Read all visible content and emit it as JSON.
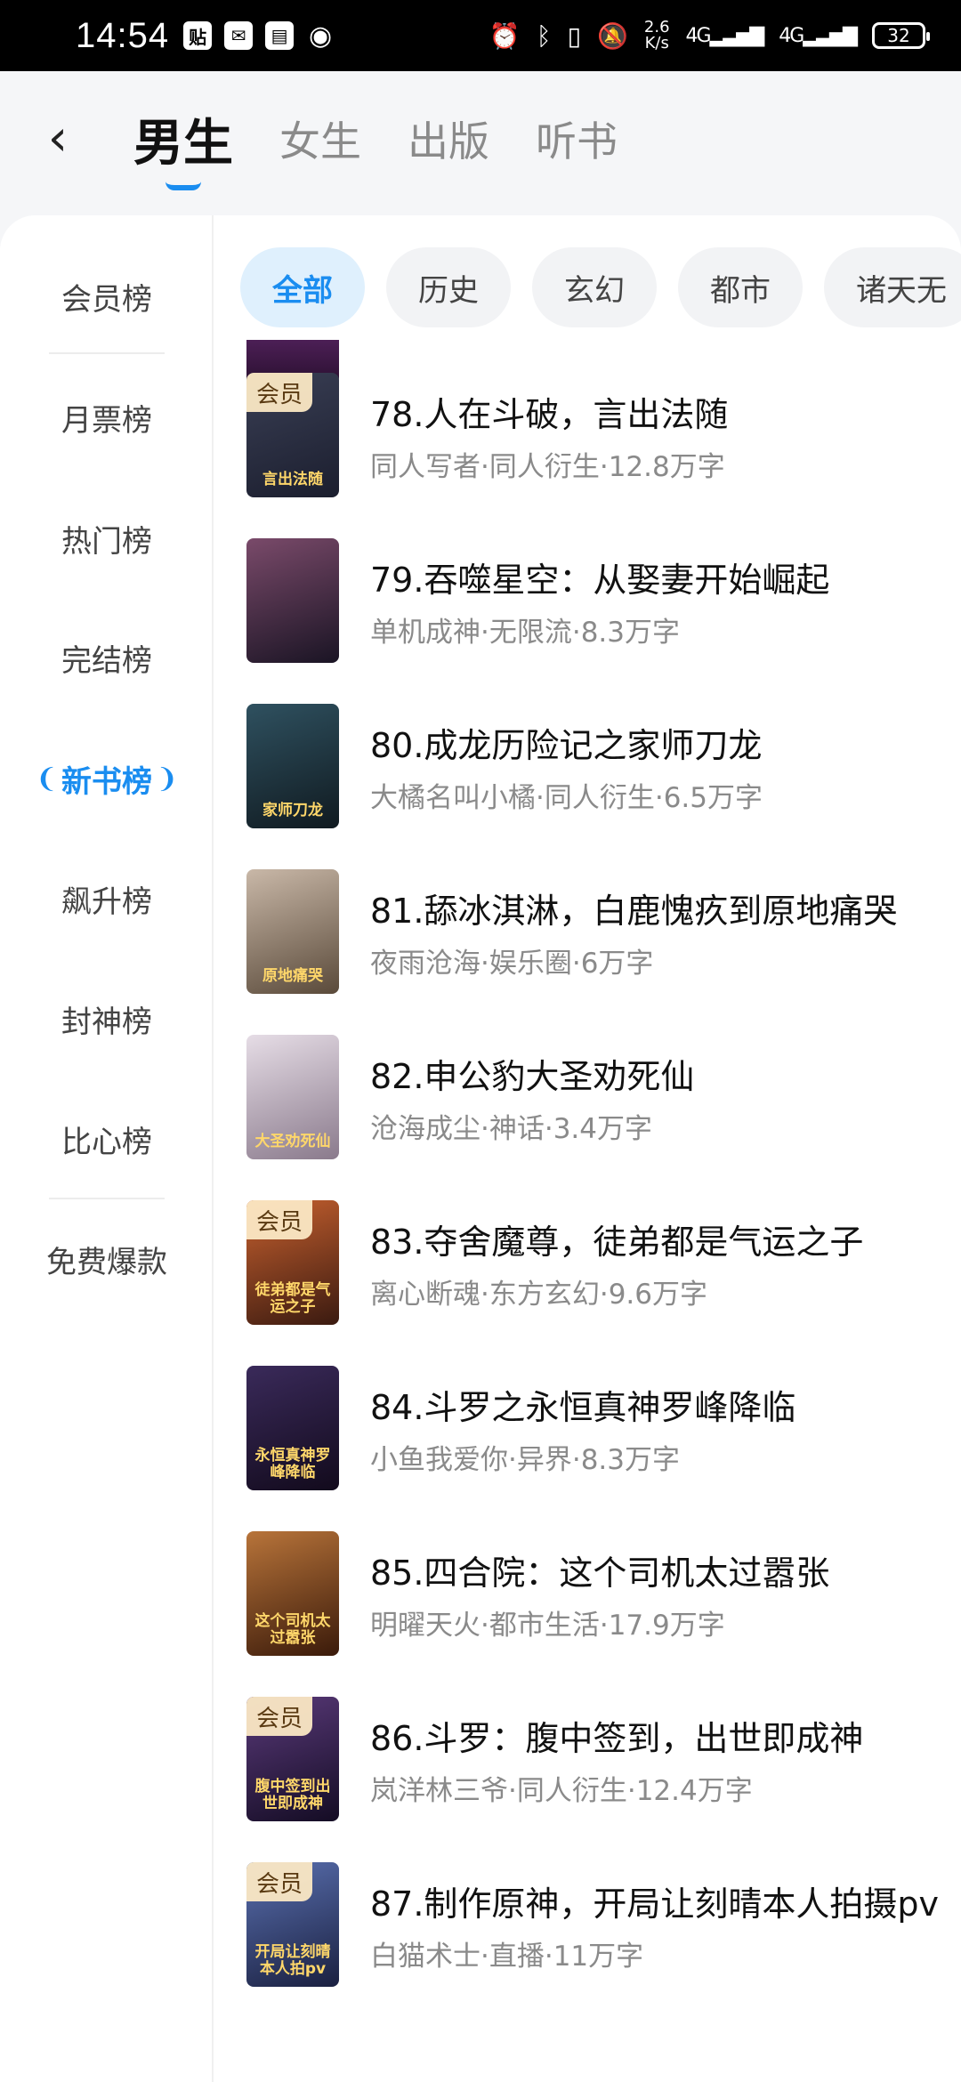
{
  "status_bar": {
    "time": "14:54",
    "net_speed": "2.6",
    "net_unit": "K/s",
    "signal1": "4G",
    "signal2": "4G",
    "battery": "32",
    "left_icons": [
      "tieba-icon",
      "wechat-icon",
      "doc-icon",
      "eye-icon"
    ],
    "right_icons": [
      "alarm-icon",
      "bluetooth-icon",
      "vibrate-icon",
      "mute-icon"
    ]
  },
  "header": {
    "back_icon": "‹",
    "tabs": [
      {
        "label": "男生",
        "active": true
      },
      {
        "label": "女生",
        "active": false
      },
      {
        "label": "出版",
        "active": false
      },
      {
        "label": "听书",
        "active": false
      }
    ]
  },
  "sidebar": {
    "items": [
      {
        "label": "会员榜"
      },
      {
        "label": "月票榜"
      },
      {
        "label": "热门榜"
      },
      {
        "label": "完结榜"
      },
      {
        "label": "新书榜",
        "active": true
      },
      {
        "label": "飙升榜"
      },
      {
        "label": "封神榜"
      },
      {
        "label": "比心榜"
      },
      {
        "label": "免费爆款"
      }
    ]
  },
  "chips": [
    {
      "label": "全部",
      "active": true
    },
    {
      "label": "历史"
    },
    {
      "label": "玄幻"
    },
    {
      "label": "都市"
    },
    {
      "label": "诸天无"
    }
  ],
  "books": [
    {
      "title": "78.人在斗破，言出法随",
      "meta": "同人写者·同人衍生·12.8万字",
      "tag": "会员",
      "cover_colors": [
        "#3a3f55",
        "#1b1e2e"
      ],
      "cover_text": "言出法随"
    },
    {
      "title": "79.吞噬星空：从娶妻开始崛起",
      "meta": "单机成神·无限流·8.3万字",
      "tag": "",
      "cover_colors": [
        "#7a4a6a",
        "#1a1424"
      ],
      "cover_text": ""
    },
    {
      "title": "80.成龙历险记之家师刀龙",
      "meta": "大橘名叫小橘·同人衍生·6.5万字",
      "tag": "",
      "cover_colors": [
        "#2f5160",
        "#101a20"
      ],
      "cover_text": "家师刀龙"
    },
    {
      "title": "81.舔冰淇淋，白鹿愧疚到原地痛哭",
      "meta": "夜雨沧海·娱乐圈·6万字",
      "tag": "",
      "cover_colors": [
        "#c9b8a8",
        "#5a4a3a"
      ],
      "cover_text": "原地痛哭"
    },
    {
      "title": "82.申公豹大圣劝死仙",
      "meta": "沧海成尘·神话·3.4万字",
      "tag": "",
      "cover_colors": [
        "#e6dde6",
        "#8a7a8c"
      ],
      "cover_text": "大圣劝死仙"
    },
    {
      "title": "83.夺舍魔尊，徒弟都是气运之子",
      "meta": "离心断魂·东方玄幻·9.6万字",
      "tag": "会员",
      "cover_colors": [
        "#c8612f",
        "#3a1a10"
      ],
      "cover_text": "徒弟都是气运之子"
    },
    {
      "title": "84.斗罗之永恒真神罗峰降临",
      "meta": "小鱼我爱你·异界·8.3万字",
      "tag": "",
      "cover_colors": [
        "#3a2a5a",
        "#120a1c"
      ],
      "cover_text": "永恒真神罗峰降临"
    },
    {
      "title": "85.四合院：这个司机太过嚣张",
      "meta": "明曜天火·都市生活·17.9万字",
      "tag": "",
      "cover_colors": [
        "#b8743a",
        "#3a1a0a"
      ],
      "cover_text": "这个司机太过嚣张"
    },
    {
      "title": "86.斗罗：腹中签到，出世即成神",
      "meta": "岚洋林三爷·同人衍生·12.4万字",
      "tag": "会员",
      "cover_colors": [
        "#5a3a7a",
        "#140c24"
      ],
      "cover_text": "腹中签到出世即成神"
    },
    {
      "title": "87.制作原神，开局让刻晴本人拍摄pv",
      "meta": "白猫术士·直播·11万字",
      "tag": "会员",
      "cover_colors": [
        "#5a70b0",
        "#1a2040"
      ],
      "cover_text": "开局让刻晴本人拍pv"
    }
  ]
}
